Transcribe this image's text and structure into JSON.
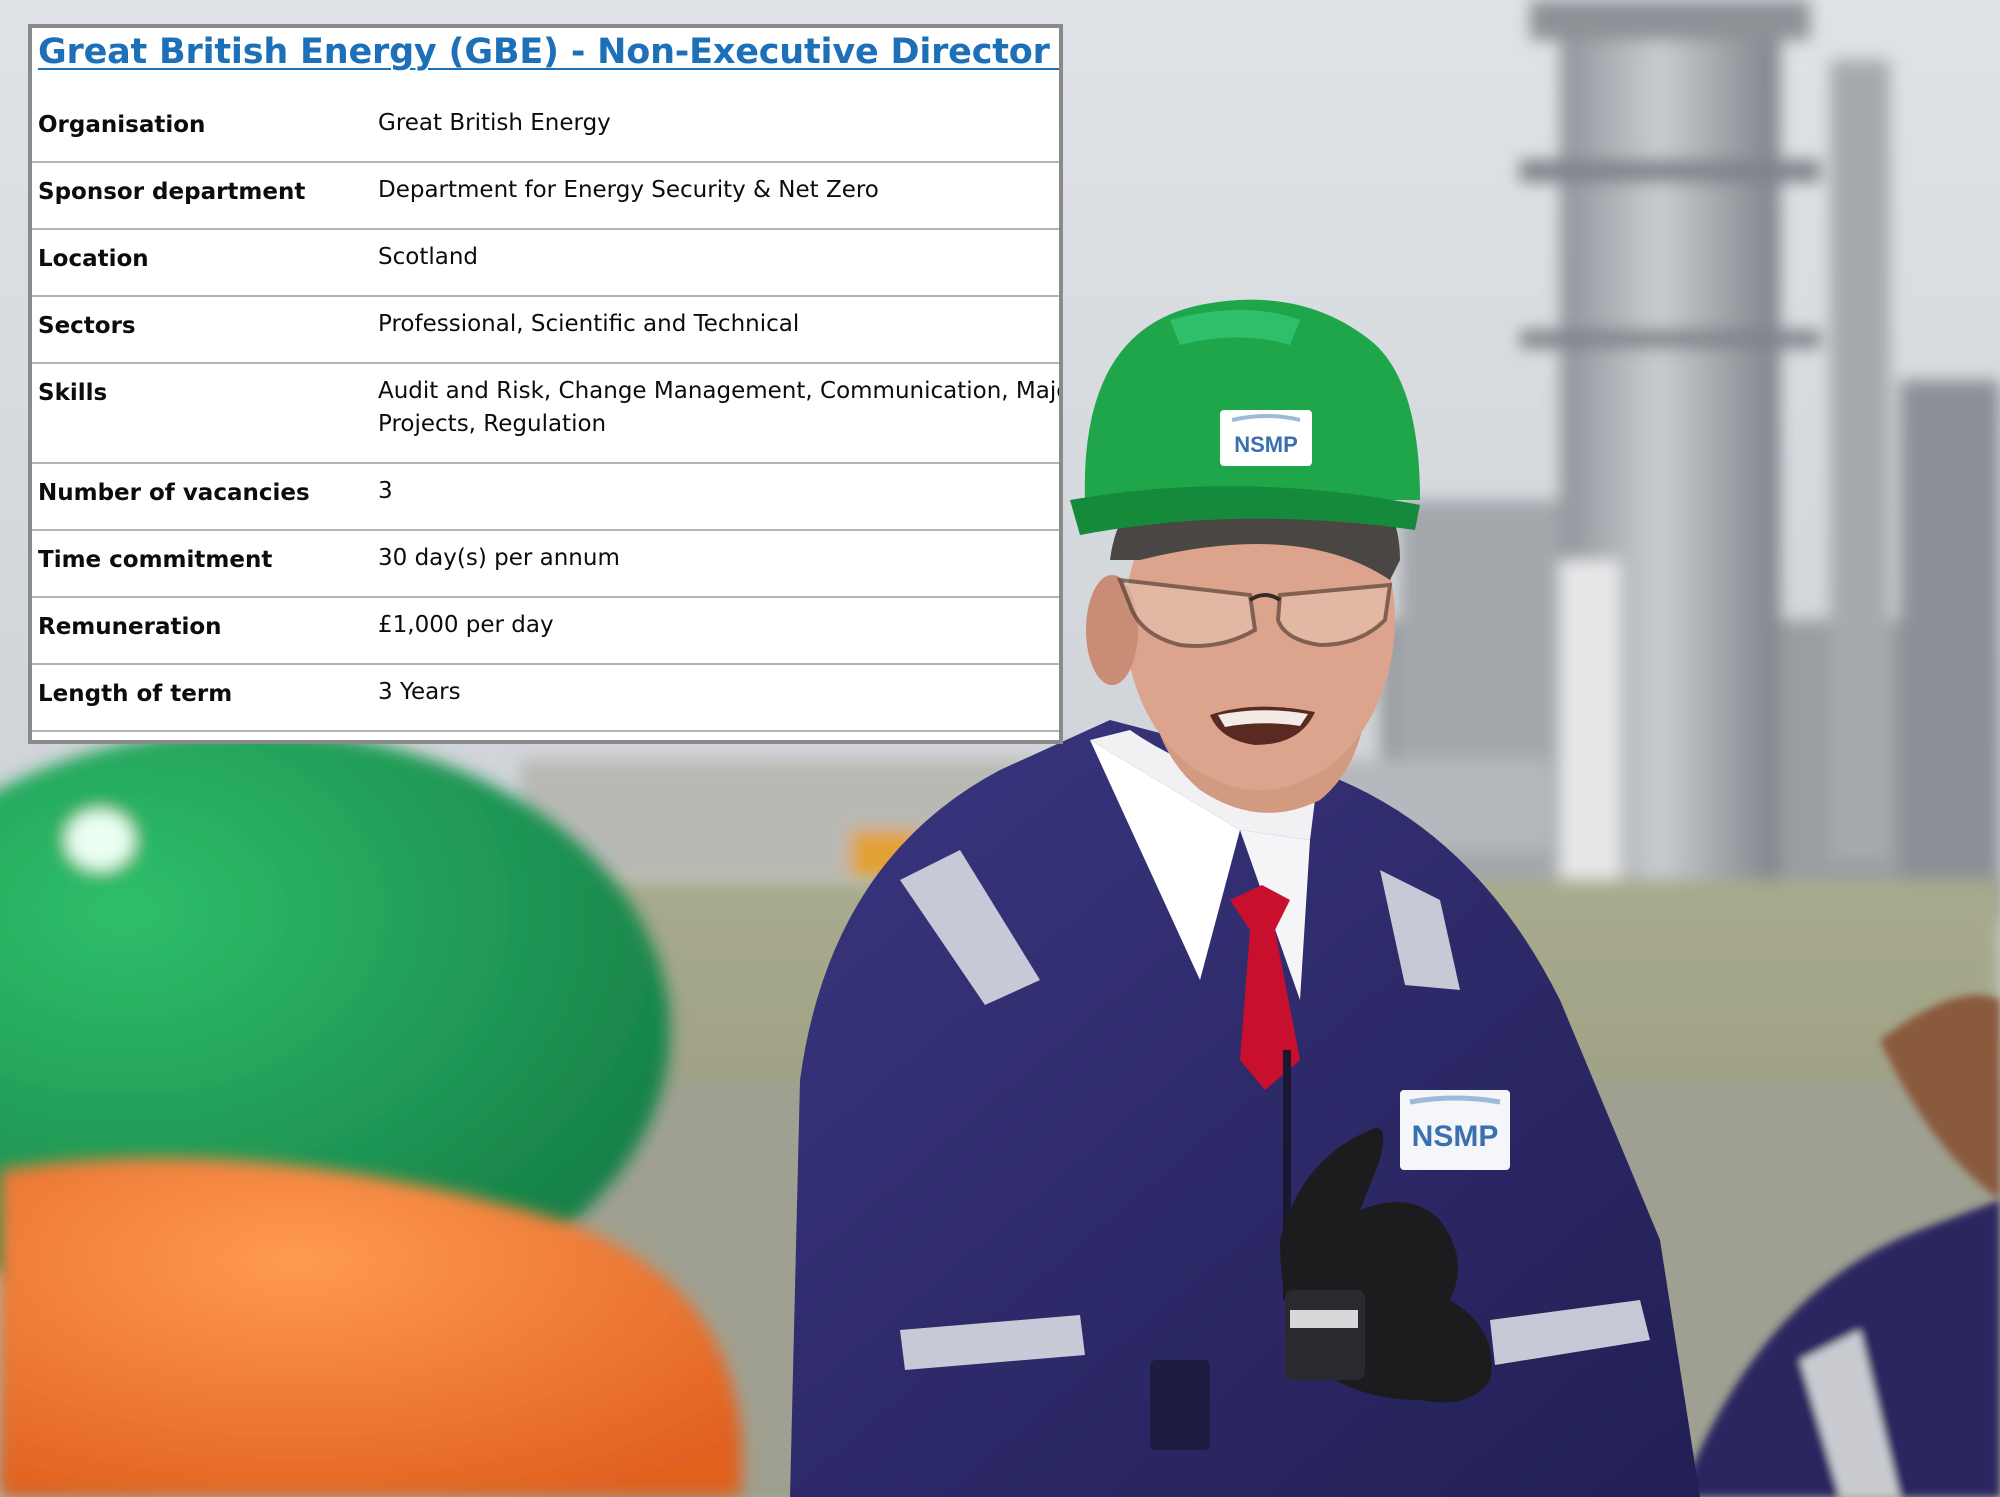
{
  "listing": {
    "title": "Great British Energy (GBE) - Non-Executive Director (NED)",
    "rows": [
      {
        "label": "Organisation",
        "value": "Great British Energy"
      },
      {
        "label": "Sponsor department",
        "value": "Department for Energy Security & Net Zero"
      },
      {
        "label": "Location",
        "value": "Scotland"
      },
      {
        "label": "Sectors",
        "value": "Professional, Scientific and Technical"
      },
      {
        "label": "Skills",
        "value": "Audit and Risk, Change Management, Communication, Major Projects, Regulation"
      },
      {
        "label": "Number of vacancies",
        "value": "3"
      },
      {
        "label": "Time commitment",
        "value": "30 day(s) per annum"
      },
      {
        "label": "Remuneration",
        "value": "£1,000 per day"
      },
      {
        "label": "Length of term",
        "value": "3 Years"
      }
    ]
  },
  "photo": {
    "helmet_badge": "NSMP",
    "chest_badge": "NSMP",
    "colors": {
      "link": "#1d70b8",
      "helmet": "#1fa64a",
      "coverall": "#2e2a66",
      "tie": "#c8102e"
    }
  }
}
